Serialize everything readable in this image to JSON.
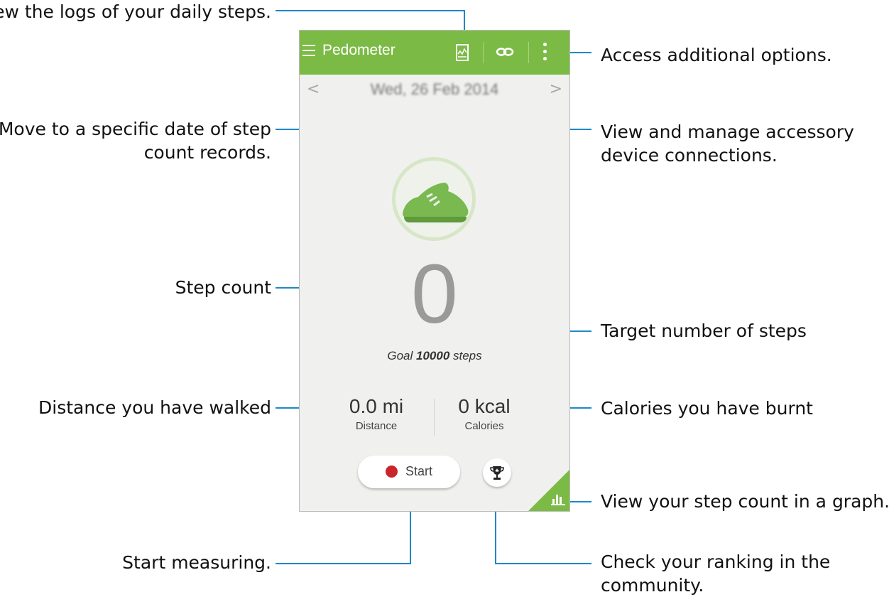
{
  "app": {
    "title": "Pedometer",
    "date": "Wed, 26 Feb 2014",
    "prev_arrow": "<",
    "next_arrow": ">",
    "step_count": "0",
    "goal_prefix": "Goal ",
    "goal_value": "10000",
    "goal_suffix": " steps",
    "distance_value": "0.0 mi",
    "distance_label": "Distance",
    "calories_value": "0 kcal",
    "calories_label": "Calories",
    "start_label": "Start",
    "accent_color": "#7cba46",
    "record_color": "#c9252b"
  },
  "icons": [
    "menu-icon",
    "log-icon",
    "link-icon",
    "more-options-icon",
    "shoe-icon",
    "trophy-icon",
    "graph-icon"
  ],
  "callouts": {
    "logs": "View the logs of your daily steps.",
    "date_line1": "Move to a specific date of step",
    "date_line2": "count records.",
    "step_count": "Step count",
    "distance": "Distance you have walked",
    "start": "Start measuring.",
    "options": "Access additional options.",
    "accessory_line1": "View and manage accessory",
    "accessory_line2": "device connections.",
    "target": "Target number of steps",
    "calories": "Calories you have burnt",
    "graph": "View your step count in a graph.",
    "ranking_line1": "Check your ranking in the",
    "ranking_line2": "community."
  }
}
